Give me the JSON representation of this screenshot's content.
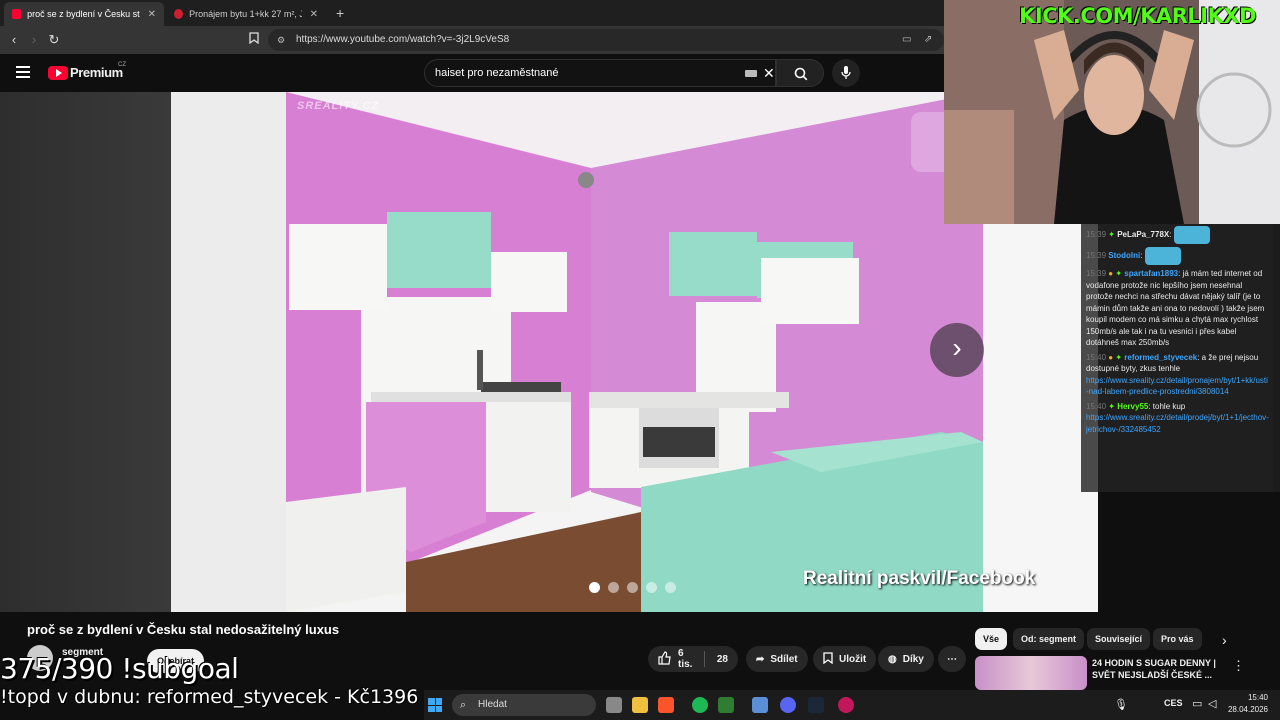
{
  "tabs": [
    {
      "title": "proč se z bydlení v Česku stal ne",
      "active": true
    },
    {
      "title": "Pronájem bytu 1+kk 27 m², Jiráskova",
      "active": false
    }
  ],
  "url": "https://www.youtube.com/watch?v=-3j2L9cVeS8",
  "yt": {
    "brand": "Premium",
    "region": "CZ",
    "search_value": "haiset pro nezaměstnané"
  },
  "photo": {
    "watermark": "SREALITY.CZ",
    "caption": "Realitní paskvil/Facebook",
    "slide_index": 1,
    "slide_count": 5
  },
  "stream": {
    "kick_handle": "KICK.COM/KARLIKXD",
    "subgoal": "375/390 !subgoal",
    "topd": "!topd v dubnu: reformed_styvecek - Kč1396"
  },
  "chat": [
    {
      "time": "15:39",
      "user": "PeLaPa_778X",
      "color": "#e9e9e9",
      "text": ":",
      "link": ""
    },
    {
      "time": "15:39",
      "user": "Stodolni",
      "color": "#3ea6ff",
      "text": ":",
      "link": ""
    },
    {
      "time": "15:39",
      "user": "spartafan1893",
      "color": "#3ea6ff",
      "text": ": já mám ted internet od vodafone protože nic lepšího jsem nesehnal protože nechci na střechu dávat nějaký talíř (je to mámin dům takže ani ona to nedovolí ) takže jsem koupil modem co má simku a chytá max rychlost 150mb/s ale tak i na tu vesnici i přes kabel dotáhneš max 250mb/s",
      "link": ""
    },
    {
      "time": "15:40",
      "user": "reformed_styvecek",
      "color": "#3ea6ff",
      "text": ": a že prej nejsou dostupné byty, zkus tenhle",
      "link": "https://www.sreality.cz/detail/pronajem/byt/1+kk/usti-nad-labem-predlice-prostredni/3808014"
    },
    {
      "time": "15:40",
      "user": "Hervy55",
      "color": "#53fc18",
      "text": ": tohle kup",
      "link": "https://www.sreality.cz/detail/prodej/byt/1+1/jecthov-jetrichov-/332485452"
    }
  ],
  "video": {
    "title": "proč se z bydlení v Česku stal nedosažitelný luxus",
    "channel": "segment",
    "subscribe_label": "Odebírat",
    "likes": "6 tis.",
    "comments": "28",
    "share_label": "Sdílet",
    "save_label": "Uložit",
    "thanks_label": "Díky"
  },
  "chips": [
    "Vše",
    "Od: segment",
    "Související",
    "Pro vás"
  ],
  "related": {
    "title": "24 HODIN S SUGAR DENNY | SVĚT NEJSLADŠÍ ČESKÉ ..."
  },
  "taskbar": {
    "search_placeholder": "Hledat",
    "lang": "CES",
    "time": "15:40",
    "date": "28.04.2026"
  }
}
